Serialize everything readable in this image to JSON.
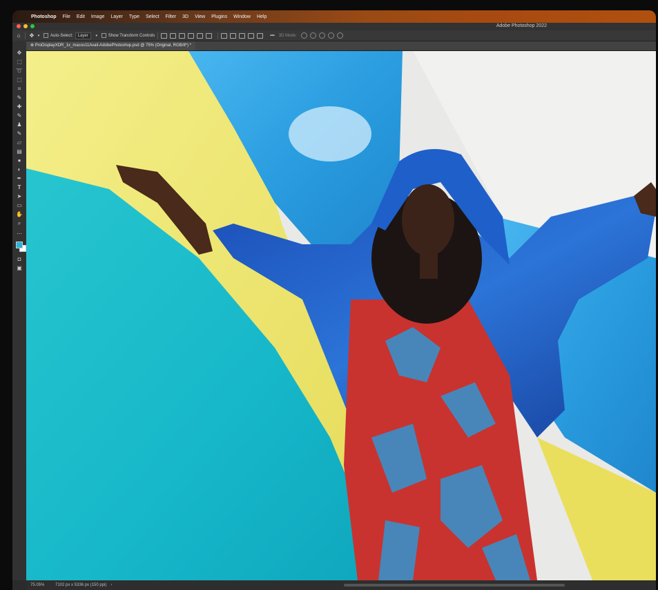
{
  "menubar": {
    "app": "Photoshop",
    "items": [
      "File",
      "Edit",
      "Image",
      "Layer",
      "Type",
      "Select",
      "Filter",
      "3D",
      "View",
      "Plugins",
      "Window",
      "Help"
    ]
  },
  "window": {
    "title": "Adobe Photoshop 2022"
  },
  "options_bar": {
    "auto_select_label": "Auto-Select:",
    "auto_select_value": "Layer",
    "transform_label": "Show Transform Controls",
    "mode_3d_label": "3D Mode:",
    "more": "•••"
  },
  "document": {
    "tab_title": "ProDisplayXDR_1x_macos11Avail-AdobePhotoshop.psd @ 75% (Original, RGB/8*) *"
  },
  "status": {
    "zoom": "75.05%",
    "info": "7102 px x 5336 px (150 ppi)",
    "arrow": "›"
  },
  "colors": {
    "foreground": "#2ab3d8",
    "background": "#ffffff",
    "accent_menubar": "#a84a10"
  },
  "tools": [
    "move-icon",
    "marquee-icon",
    "lasso-icon",
    "object-select-icon",
    "crop-icon",
    "eyedropper-icon",
    "healing-icon",
    "brush-icon",
    "clone-stamp-icon",
    "history-brush-icon",
    "eraser-icon",
    "gradient-icon",
    "blur-icon",
    "dodge-icon",
    "pen-icon",
    "type-icon",
    "path-select-icon",
    "shape-icon",
    "hand-icon",
    "zoom-icon",
    "more-tools-icon"
  ]
}
